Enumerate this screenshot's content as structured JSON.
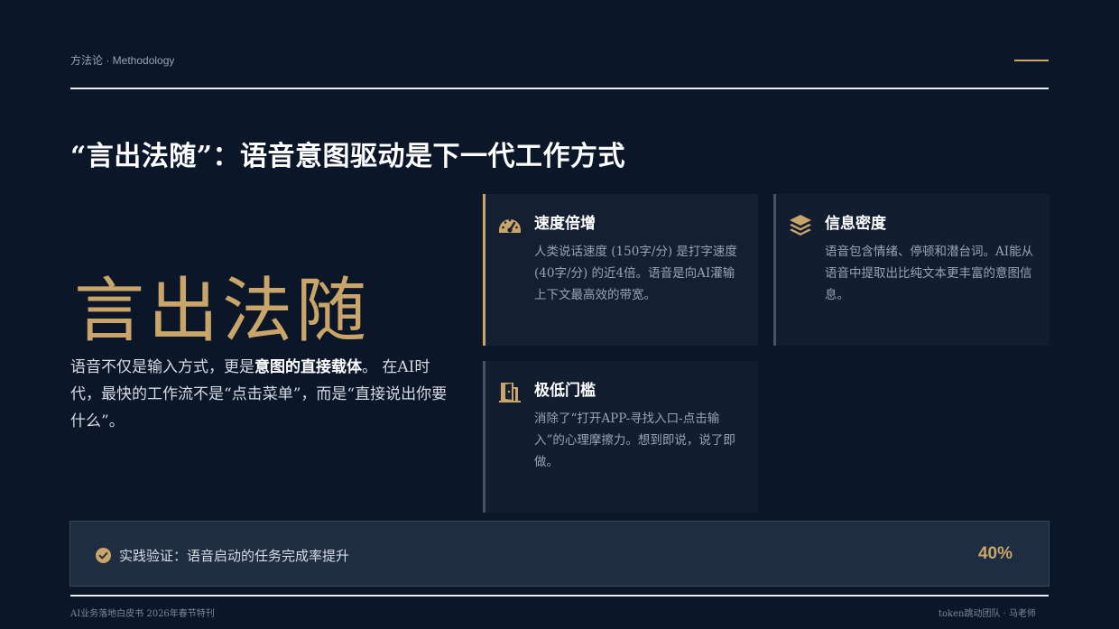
{
  "header": {
    "section_label": "方法论 · Methodology"
  },
  "title": "“言出法随”：语音意图驱动是下一代工作方式",
  "big_phrase": "言出法随",
  "intro": {
    "part1": "语音不仅是输入方式，更是",
    "highlight": "意图的直接载体",
    "part2": "。 在AI时代，最快的工作流不是“点击菜单”，而是“直接说出你要什么”。"
  },
  "cards": [
    {
      "icon": "speedometer-icon",
      "title": "速度倍增",
      "body": "人类说话速度 (150字/分) 是打字速度 (40字/分) 的近4倍。语音是向AI灌输上下文最高效的带宽。"
    },
    {
      "icon": "layers-icon",
      "title": "信息密度",
      "body": "语音包含情绪、停顿和潜台词。AI能从语音中提取出比纯文本更丰富的意图信息。"
    },
    {
      "icon": "door-icon",
      "title": "极低门槛",
      "body": "消除了“打开APP-寻找入口-点击输入”的心理摩擦力。想到即说，说了即做。"
    }
  ],
  "banner": {
    "icon": "check-circle-icon",
    "text": "实践验证：语音启动的任务完成率提升",
    "value": "40%"
  },
  "footer": {
    "left": "AI业务落地白皮书 2026年春节特刊",
    "right": "token跳动团队 · 马老师"
  },
  "colors": {
    "background": "#0b1628",
    "accent_gold": "#c9a56a",
    "card": "#121d30"
  }
}
